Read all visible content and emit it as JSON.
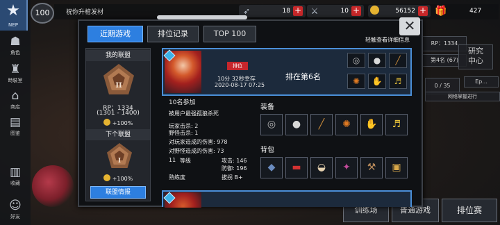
{
  "leftnav": {
    "items": [
      {
        "label": "NEP",
        "icon": "star-icon"
      },
      {
        "label": "角色",
        "icon": "character-icon"
      },
      {
        "label": "時裝室",
        "icon": "wardrobe-icon"
      },
      {
        "label": "商店",
        "icon": "shop-icon"
      },
      {
        "label": "图鉴",
        "icon": "collection-icon"
      },
      {
        "label": "收藏",
        "icon": "book-icon"
      },
      {
        "label": "好友",
        "icon": "friends-icon"
      }
    ]
  },
  "topbar": {
    "level": "100",
    "player_title": "祝你升棺发材",
    "resources": [
      {
        "icon": "feather-icon",
        "value": "18"
      },
      {
        "icon": "dagger-icon",
        "value": "10"
      },
      {
        "icon": "coin-icon",
        "value": "56152"
      }
    ],
    "gift_count": "427"
  },
  "background_right": {
    "rp_text": "RP：1334",
    "rank_text": "第4名 (67)",
    "research": "研究\n中心",
    "event": "Ep...",
    "progress": "0 / 35",
    "progress_label": "网络掌握进行",
    "bottom_buttons": [
      "训练场",
      "普通游戏",
      "排位赛"
    ]
  },
  "modal": {
    "tabs": [
      {
        "label": "近期游戏",
        "active": true
      },
      {
        "label": "排位记录",
        "active": false
      },
      {
        "label": "TOP 100",
        "active": false
      }
    ],
    "detail_hint": "轻触查看详细信息",
    "my_league": {
      "title": "我的联盟",
      "tier": "II",
      "rp": "RP：1334",
      "range": "(1301 - 1400)",
      "bonus": "+100%"
    },
    "next_league": {
      "title": "下个联盟",
      "tier": "I",
      "bonus": "+100%"
    },
    "league_info_button": "联盟情报",
    "match": {
      "mode": "排位",
      "survival": "10分 32秒幸存",
      "date": "2020-08-17 07:25",
      "placement": "排在第6名",
      "items": [
        "ring-icon",
        "bullet-icon",
        "wand-icon",
        "orb-icon",
        "gauntlet-icon",
        "horn-icon"
      ]
    },
    "details": {
      "participants": "10名参加",
      "killed_by": "被用户最强孤狼杀死",
      "player_kills": "玩家击杀: 2",
      "monster_kills": "野怪击杀: 1",
      "damage_to_players": "对玩家造成的伤害: 978",
      "damage_to_monsters": "对野怪造成的伤害: 73",
      "level_value": "11",
      "level_label": "等级",
      "attack": "攻击: 146",
      "defense": "防御: 196",
      "proficiency_label": "熟练度",
      "proficiency_value": "拔拐 B+",
      "equipment_title": "装备",
      "equipment": [
        "ring-icon",
        "bullet-icon",
        "wand-icon",
        "orb-icon",
        "gauntlet-icon",
        "horn-icon"
      ],
      "bag_title": "背包",
      "bag": [
        "stone-icon",
        "lighter-icon",
        "bowl-icon",
        "potion-icon",
        "pickaxe-icon",
        "scroll-icon"
      ]
    }
  }
}
